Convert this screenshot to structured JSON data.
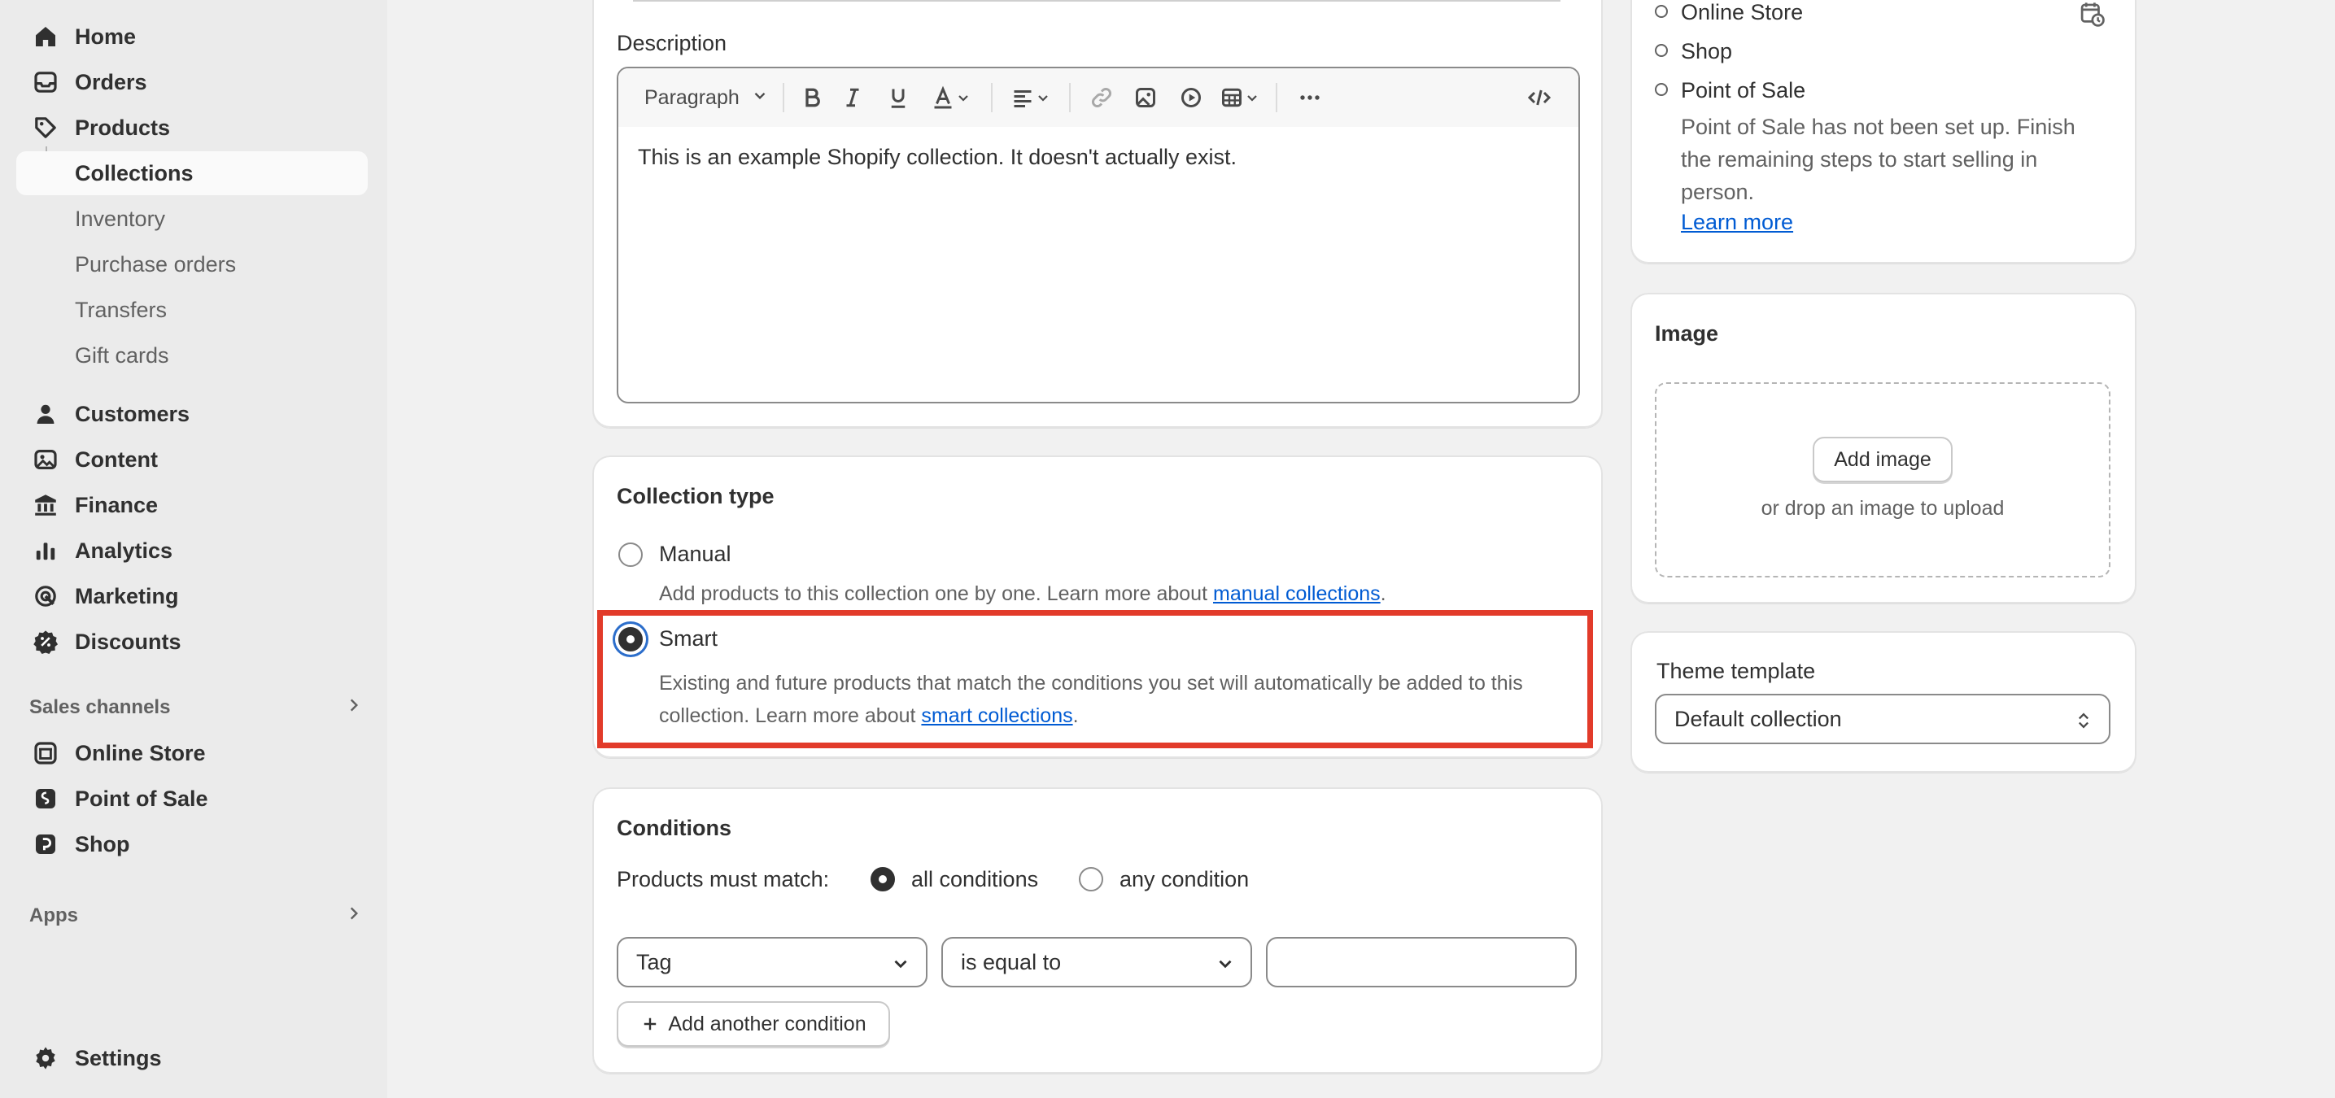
{
  "sidebar": {
    "nav": [
      {
        "label": "Home",
        "icon": "home-icon"
      },
      {
        "label": "Orders",
        "icon": "orders-icon"
      },
      {
        "label": "Products",
        "icon": "tag-icon"
      },
      {
        "label": "Collections"
      },
      {
        "label": "Inventory"
      },
      {
        "label": "Purchase orders"
      },
      {
        "label": "Transfers"
      },
      {
        "label": "Gift cards"
      },
      {
        "label": "Customers",
        "icon": "person-icon"
      },
      {
        "label": "Content",
        "icon": "content-icon"
      },
      {
        "label": "Finance",
        "icon": "bank-icon"
      },
      {
        "label": "Analytics",
        "icon": "chart-icon"
      },
      {
        "label": "Marketing",
        "icon": "target-icon"
      },
      {
        "label": "Discounts",
        "icon": "discount-icon"
      }
    ],
    "sales_channels_label": "Sales channels",
    "channels": [
      {
        "label": "Online Store",
        "icon": "store-icon"
      },
      {
        "label": "Point of Sale",
        "icon": "pos-icon"
      },
      {
        "label": "Shop",
        "icon": "shop-icon"
      }
    ],
    "apps_label": "Apps",
    "settings_label": "Settings"
  },
  "description": {
    "label": "Description",
    "format_select": "Paragraph",
    "body": "This is an example Shopify collection. It doesn't actually exist."
  },
  "collection_type": {
    "title": "Collection type",
    "manual_label": "Manual",
    "manual_help": "Add products to this collection one by one. Learn more about",
    "manual_link": "manual collections",
    "smart_label": "Smart",
    "smart_help_1": "Existing and future products that match the conditions you set will automatically be added to this",
    "smart_help_2": "collection. Learn more about",
    "smart_link": "smart collections",
    "selected": "Smart"
  },
  "conditions": {
    "title": "Conditions",
    "match_label": "Products must match:",
    "all_label": "all conditions",
    "any_label": "any condition",
    "selected": "all conditions",
    "field": "Tag",
    "operator": "is equal to",
    "value": "",
    "add_button": "Add another condition"
  },
  "publishing": {
    "channels": [
      "Online Store",
      "Shop",
      "Point of Sale"
    ],
    "pos_note_1": "Point of Sale has not been set up. Finish",
    "pos_note_2": "the remaining steps to start selling in",
    "pos_note_3": "person.",
    "learn_more": "Learn more"
  },
  "image": {
    "title": "Image",
    "add_button": "Add image",
    "drop_hint": "or drop an image to upload"
  },
  "theme_template": {
    "label": "Theme template",
    "value": "Default collection"
  },
  "colors": {
    "link": "#005bd3",
    "highlight": "#e23b2a",
    "selected_radio": "#303030"
  }
}
